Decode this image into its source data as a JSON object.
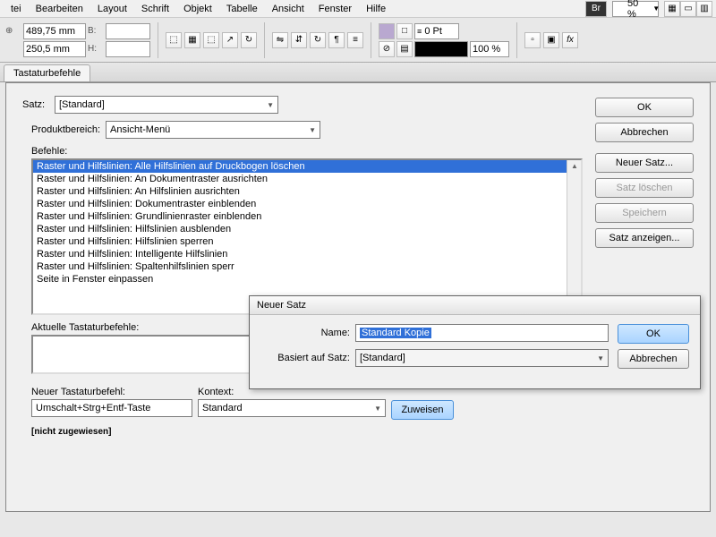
{
  "menu": {
    "items": [
      "tei",
      "Bearbeiten",
      "Layout",
      "Schrift",
      "Objekt",
      "Tabelle",
      "Ansicht",
      "Fenster",
      "Hilfe"
    ]
  },
  "topbar": {
    "br": "Br",
    "zoom": "50 %"
  },
  "measure": {
    "x": "489,75 mm",
    "y": "250,5 mm",
    "b": "B:",
    "h": "H:",
    "pt": "0 Pt",
    "pct": "100 %"
  },
  "tab": {
    "title": "Tastaturbefehle"
  },
  "dlg": {
    "satz_label": "Satz:",
    "satz_value": "[Standard]",
    "prod_label": "Produktbereich:",
    "prod_value": "Ansicht-Menü",
    "cmds_label": "Befehle:",
    "cmds": [
      "Raster und Hilfslinien: Alle Hilfslinien auf Druckbogen löschen",
      "Raster und Hilfslinien: An Dokumentraster ausrichten",
      "Raster und Hilfslinien: An Hilfslinien ausrichten",
      "Raster und Hilfslinien: Dokumentraster einblenden",
      "Raster und Hilfslinien: Grundlinienraster einblenden",
      "Raster und Hilfslinien: Hilfslinien ausblenden",
      "Raster und Hilfslinien: Hilfslinien sperren",
      "Raster und Hilfslinien: Intelligente Hilfslinien",
      "Raster und Hilfslinien: Spaltenhilfslinien sperr",
      "Seite in Fenster einpassen"
    ],
    "current_label": "Aktuelle Tastaturbefehle:",
    "new_label": "Neuer Tastaturbefehl:",
    "context_label": "Kontext:",
    "shortcut_value": "Umschalt+Strg+Entf-Taste",
    "context_value": "Standard",
    "assign": "Zuweisen",
    "not_assigned": "[nicht zugewiesen]"
  },
  "side": {
    "ok": "OK",
    "cancel": "Abbrechen",
    "new": "Neuer Satz...",
    "delete": "Satz löschen",
    "save": "Speichern",
    "show": "Satz anzeigen..."
  },
  "modal": {
    "title": "Neuer Satz",
    "name_label": "Name:",
    "name_value": "Standard Kopie",
    "based_label": "Basiert auf Satz:",
    "based_value": "[Standard]",
    "ok": "OK",
    "cancel": "Abbrechen"
  }
}
